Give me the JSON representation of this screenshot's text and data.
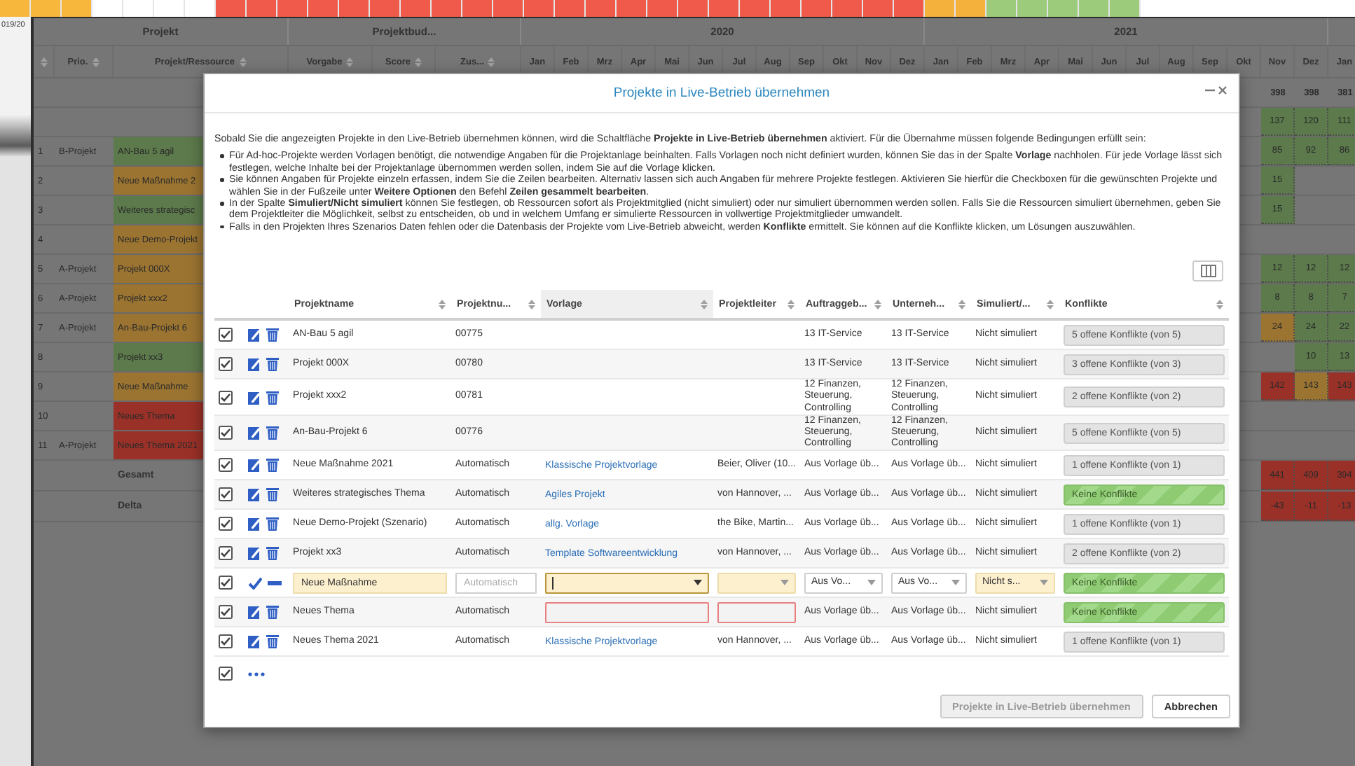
{
  "top_strip": [
    {
      "color": "#f6b73c"
    },
    {
      "color": "#f6b73c"
    },
    {
      "color": "#f6b73c"
    },
    {
      "color": "#ffffff"
    },
    {
      "color": "#ffffff"
    },
    {
      "color": "#ffffff"
    },
    {
      "color": "#ffffff"
    },
    {
      "color": "#ef5a4a"
    },
    {
      "color": "#ef5a4a"
    },
    {
      "color": "#ef5a4a"
    },
    {
      "color": "#ef5a4a"
    },
    {
      "color": "#ef5a4a"
    },
    {
      "color": "#ef5a4a"
    },
    {
      "color": "#ef5a4a"
    },
    {
      "color": "#ef5a4a"
    },
    {
      "color": "#ef5a4a"
    },
    {
      "color": "#ef5a4a"
    },
    {
      "color": "#ef5a4a"
    },
    {
      "color": "#ef5a4a"
    },
    {
      "color": "#ef5a4a"
    },
    {
      "color": "#ef5a4a"
    },
    {
      "color": "#ef5a4a"
    },
    {
      "color": "#ef5a4a"
    },
    {
      "color": "#ef5a4a"
    },
    {
      "color": "#ef5a4a"
    },
    {
      "color": "#ef5a4a"
    },
    {
      "color": "#ef5a4a"
    },
    {
      "color": "#ef5a4a"
    },
    {
      "color": "#ef5a4a"
    },
    {
      "color": "#ef5a4a"
    },
    {
      "color": "#f4b23d"
    },
    {
      "color": "#f4b23d"
    },
    {
      "color": "#9dcb7c"
    },
    {
      "color": "#9dcb7c"
    },
    {
      "color": "#9dcb7c"
    },
    {
      "color": "#9dcb7c"
    },
    {
      "color": "#9dcb7c"
    }
  ],
  "side_panel": {
    "label": "019/20"
  },
  "grid": {
    "groups": [
      {
        "label": "Projekt"
      },
      {
        "label": "Projektbud..."
      },
      {
        "label": "2020"
      },
      {
        "label": "2021"
      }
    ],
    "columns": [
      {
        "sortable": true
      },
      {
        "label": "Prio.",
        "sortable": true
      },
      {
        "label": "Projekt/Ressource",
        "sortable": true
      },
      {
        "label": "Vorgabe",
        "sortable": true
      },
      {
        "label": "Score",
        "sortable": true
      },
      {
        "label": "Zus...",
        "sortable": true
      },
      {
        "label": "Jan",
        "sortable": false
      },
      {
        "label": "Feb",
        "sortable": false
      },
      {
        "label": "Mrz",
        "sortable": false
      },
      {
        "label": "Apr",
        "sortable": false
      },
      {
        "label": "Mai",
        "sortable": false
      },
      {
        "label": "Jun",
        "sortable": false
      },
      {
        "label": "Jul",
        "sortable": false
      },
      {
        "label": "Aug",
        "sortable": false
      },
      {
        "label": "Sep",
        "sortable": false
      },
      {
        "label": "Okt",
        "sortable": false
      },
      {
        "label": "Nov",
        "sortable": false
      },
      {
        "label": "Dez",
        "sortable": false
      },
      {
        "label": "Jan",
        "sortable": false
      },
      {
        "label": "Feb",
        "sortable": false
      },
      {
        "label": "Mrz",
        "sortable": false
      },
      {
        "label": "Apr",
        "sortable": false
      },
      {
        "label": "Mai",
        "sortable": false
      },
      {
        "label": "Jun",
        "sortable": false
      },
      {
        "label": "Jul",
        "sortable": false
      },
      {
        "label": "Aug",
        "sortable": false
      },
      {
        "label": "Sep",
        "sortable": false
      },
      {
        "label": "Okt",
        "sortable": false
      },
      {
        "label": "Nov",
        "sortable": false
      },
      {
        "label": "Dez",
        "sortable": false
      },
      {
        "label": "Jan",
        "sortable": false
      }
    ],
    "totals": [
      {
        "cells": [
          {
            "kind": "plain",
            "text": "398"
          },
          {
            "kind": "plain",
            "text": "398"
          },
          {
            "kind": "plain",
            "text": "381"
          }
        ]
      },
      {
        "cells": [
          {
            "kind": "value",
            "text": "137",
            "color": "#5c7a4b"
          },
          {
            "kind": "value",
            "text": "120",
            "color": "#5c7a4b"
          },
          {
            "kind": "value",
            "text": "111",
            "color": "#5c7a4b"
          }
        ]
      }
    ],
    "rows": [
      {
        "no": "1",
        "prio": "B-Projekt",
        "name": "AN-Bau 5 agil",
        "color": "#5c7a4b",
        "cells": [
          {
            "kind": "value",
            "text": "85",
            "color": "#5c7a4b"
          },
          {
            "kind": "value",
            "text": "92",
            "color": "#5c7a4b"
          },
          {
            "kind": "value",
            "text": "86",
            "color": "#5c7a4b"
          }
        ]
      },
      {
        "no": "2",
        "name": "Neue Maßnahme 2",
        "color": "#9b7431",
        "cells": [
          {
            "kind": "value",
            "text": "15",
            "color": "#5c7a4b"
          },
          {
            "kind": "empty"
          },
          {
            "kind": "empty"
          }
        ]
      },
      {
        "no": "3",
        "name": "Weiteres strategisc",
        "color": "#5c7a4b",
        "cells": [
          {
            "kind": "value",
            "text": "15",
            "color": "#5c7a4b"
          },
          {
            "kind": "empty"
          },
          {
            "kind": "empty"
          }
        ]
      },
      {
        "no": "4",
        "name": "Neue Demo-Projekt",
        "color": "#9b7431",
        "cells": [
          {
            "kind": "empty"
          },
          {
            "kind": "empty"
          },
          {
            "kind": "empty"
          }
        ]
      },
      {
        "no": "5",
        "prio": "A-Projekt",
        "name": "Projekt 000X",
        "color": "#9b7431",
        "cells": [
          {
            "kind": "value",
            "text": "12",
            "color": "#5c7a4b"
          },
          {
            "kind": "value",
            "text": "12",
            "color": "#5c7a4b"
          },
          {
            "kind": "value",
            "text": "12",
            "color": "#5c7a4b"
          }
        ]
      },
      {
        "no": "6",
        "prio": "A-Projekt",
        "name": "Projekt xxx2",
        "color": "#9b7431",
        "cells": [
          {
            "kind": "value",
            "text": "8",
            "color": "#5c7a4b"
          },
          {
            "kind": "value",
            "text": "8",
            "color": "#5c7a4b"
          },
          {
            "kind": "value",
            "text": "7",
            "color": "#5c7a4b"
          }
        ]
      },
      {
        "no": "7",
        "prio": "A-Projekt",
        "name": "An-Bau-Projekt 6",
        "color": "#9b7431",
        "cells": [
          {
            "kind": "value",
            "text": "24",
            "color": "#9b7431"
          },
          {
            "kind": "value",
            "text": "24",
            "color": "#5c7a4b"
          },
          {
            "kind": "value",
            "text": "22",
            "color": "#5c7a4b"
          }
        ]
      },
      {
        "no": "8",
        "name": "Projekt xx3",
        "color": "#5c7a4b",
        "cells": [
          {
            "kind": "empty"
          },
          {
            "kind": "value",
            "text": "10",
            "color": "#5c7a4b"
          },
          {
            "kind": "value",
            "text": "13",
            "color": "#5c7a4b"
          }
        ]
      },
      {
        "no": "9",
        "name": "Neue Maßnahme",
        "color": "#9b7431",
        "cells": [
          {
            "kind": "value",
            "text": "142",
            "color": "#9a3128"
          },
          {
            "kind": "value",
            "text": "143",
            "color": "#9b7431"
          },
          {
            "kind": "value",
            "text": "143",
            "color": "#9a3128"
          }
        ]
      },
      {
        "no": "10",
        "name": "Neues Thema",
        "color": "#9a3128",
        "cells": [
          {
            "kind": "empty"
          },
          {
            "kind": "empty"
          },
          {
            "kind": "empty"
          }
        ]
      },
      {
        "no": "11",
        "prio": "A-Projekt",
        "name": "Neues Thema 2021",
        "color": "#9a3128",
        "cells": [
          {
            "kind": "empty"
          },
          {
            "kind": "empty"
          },
          {
            "kind": "empty"
          }
        ]
      }
    ],
    "sums": [
      {
        "label": "Gesamt",
        "cells": [
          {
            "kind": "value",
            "text": "441",
            "color": "#9a3128"
          },
          {
            "kind": "value",
            "text": "409",
            "color": "#9a3128"
          },
          {
            "kind": "value",
            "text": "394",
            "color": "#9a3128"
          }
        ]
      },
      {
        "label": "Delta",
        "cells": [
          {
            "kind": "value",
            "text": "-43",
            "color": "#9a3128"
          },
          {
            "kind": "value",
            "text": "-11",
            "color": "#9a3128"
          },
          {
            "kind": "value",
            "text": "-13",
            "color": "#9a3128"
          }
        ]
      }
    ]
  },
  "dialog": {
    "title": "Projekte in Live-Betrieb übernehmen",
    "intro": "Sobald Sie die angezeigten Projekte in den Live-Betrieb übernehmen können, wird die Schaltfläche **Projekte in Live-Betrieb übernehmen** aktiviert. Für die Übernahme müssen folgende Bedingungen erfüllt sein:",
    "bullets": [
      "Für Ad-hoc-Projekte werden Vorlagen benötigt, die notwendige Angaben für die Projektanlage beinhalten. Falls Vorlagen noch nicht definiert wurden, können Sie das in der Spalte **Vorlage** nachholen. Für jede Vorlage lässt sich festlegen, welche Inhalte bei der Projektanlage übernommen werden sollen, indem Sie auf die Vorlage klicken.",
      "Sie können Angaben für Projekte einzeln erfassen, indem Sie die Zeilen bearbeiten. Alternativ lassen sich auch Angaben für mehrere Projekte festlegen. Aktivieren Sie hierfür die Checkboxen für die gewünschten Projekte und wählen Sie in der Fußzeile unter **Weitere Optionen** den Befehl **Zeilen gesammelt bearbeiten**.",
      "In der Spalte **Simuliert/Nicht simuliert** können Sie festlegen, ob Ressourcen sofort als Projektmitglied (nicht simuliert) oder nur simuliert übernommen werden sollen. Falls Sie die Ressourcen simuliert übernehmen, geben Sie dem Projektleiter die Möglichkeit, selbst zu entscheiden, ob und in welchem Umfang er simulierte Ressourcen in vollwertige Projektmitglieder umwandelt.",
      "Falls in den Projekten Ihres Szenarios Daten fehlen oder die Datenbasis der Projekte vom Live-Betrieb abweicht, werden **Konflikte** ermittelt. Sie können auf die Konflikte klicken, um Lösungen auszuwählen."
    ],
    "table": {
      "columns": [
        {
          "label": "Projektname",
          "sorted": false
        },
        {
          "label": "Projektnu...",
          "sorted": false
        },
        {
          "label": "Vorlage",
          "sorted": true
        },
        {
          "label": "Projektleiter",
          "sorted": false
        },
        {
          "label": "Auftraggeb...",
          "sorted": false
        },
        {
          "label": "Unterneh...",
          "sorted": false
        },
        {
          "label": "Simuliert/...",
          "sorted": false
        },
        {
          "label": "Konflikte",
          "sorted": false
        }
      ],
      "rows": [
        {
          "kind": "view",
          "checked": true,
          "name": "AN-Bau 5 agil",
          "number": "00775",
          "client": "13 IT-Service",
          "company": "13 IT-Service",
          "simulated": "Nicht simuliert",
          "conflicts": "5 offene Konflikte (von 5)",
          "resolved": false,
          "invalid": false
        },
        {
          "kind": "view",
          "checked": true,
          "name": "Projekt 000X",
          "number": "00780",
          "client": "13 IT-Service",
          "company": "13 IT-Service",
          "simulated": "Nicht simuliert",
          "conflicts": "3 offene Konflikte (von 3)",
          "resolved": false,
          "invalid": false
        },
        {
          "kind": "view",
          "checked": true,
          "name": "Projekt xxx2",
          "number": "00781",
          "client": "12 Finanzen, Steuerung, Controlling",
          "company": "12 Finanzen, Steuerung, Controlling",
          "simulated": "Nicht simuliert",
          "conflicts": "2 offene Konflikte (von 2)",
          "resolved": false,
          "invalid": false
        },
        {
          "kind": "view",
          "checked": true,
          "name": "An-Bau-Projekt 6",
          "number": "00776",
          "client": "12 Finanzen, Steuerung, Controlling",
          "company": "12 Finanzen, Steuerung, Controlling",
          "simulated": "Nicht simuliert",
          "conflicts": "5 offene Konflikte (von 5)",
          "resolved": false,
          "invalid": false
        },
        {
          "kind": "view",
          "checked": true,
          "name": "Neue Maßnahme 2021",
          "number": "Automatisch",
          "template": "Klassische Projektvorlage",
          "leader": "Beier, Oliver (10...",
          "client": "Aus Vorlage üb...",
          "company": "Aus Vorlage üb...",
          "simulated": "Nicht simuliert",
          "conflicts": "1 offene Konflikte (von 1)",
          "resolved": false,
          "invalid": false
        },
        {
          "kind": "view",
          "checked": true,
          "name": "Weiteres strategisches Thema",
          "number": "Automatisch",
          "template": "Agiles Projekt",
          "leader": "von Hannover, ...",
          "client": "Aus Vorlage üb...",
          "company": "Aus Vorlage üb...",
          "simulated": "Nicht simuliert",
          "conflicts": "Keine Konflikte",
          "resolved": true,
          "invalid": false
        },
        {
          "kind": "view",
          "checked": true,
          "name": "Neue Demo-Projekt (Szenario)",
          "number": "Automatisch",
          "template": "allg. Vorlage",
          "leader": "the Bike, Martin...",
          "client": "Aus Vorlage üb...",
          "company": "Aus Vorlage üb...",
          "simulated": "Nicht simuliert",
          "conflicts": "1 offene Konflikte (von 1)",
          "resolved": false,
          "invalid": false
        },
        {
          "kind": "view",
          "checked": true,
          "name": "Projekt xx3",
          "number": "Automatisch",
          "template": "Template Softwareentwicklung",
          "leader": "von Hannover, ...",
          "client": "Aus Vorlage üb...",
          "company": "Aus Vorlage üb...",
          "simulated": "Nicht simuliert",
          "conflicts": "2 offene Konflikte (von 2)",
          "resolved": false,
          "invalid": false
        },
        {
          "kind": "edit",
          "checked": true,
          "fields": [
            {
              "kind": "text",
              "value": "Neue Maßnahme",
              "required": true
            },
            {
              "kind": "text",
              "placeholder": "Automatisch",
              "required": false
            },
            {
              "kind": "select",
              "required": true,
              "focused": true
            },
            {
              "kind": "select",
              "required": true,
              "focused": false
            },
            {
              "kind": "select",
              "value": "Aus Vo...",
              "required": false,
              "focused": false
            },
            {
              "kind": "select",
              "value": "Aus Vo...",
              "required": false,
              "focused": false
            },
            {
              "kind": "select",
              "value": "Nicht s...",
              "required": true,
              "focused": false
            }
          ],
          "conflicts": "Keine Konflikte",
          "resolved": true
        },
        {
          "kind": "view",
          "checked": true,
          "name": "Neues Thema",
          "number": "Automatisch",
          "client": "Aus Vorlage üb...",
          "company": "Aus Vorlage üb...",
          "simulated": "Nicht simuliert",
          "conflicts": "Keine Konflikte",
          "resolved": true,
          "invalid": true
        },
        {
          "kind": "view",
          "checked": true,
          "name": "Neues Thema 2021",
          "number": "Automatisch",
          "template": "Klassische Projektvorlage",
          "leader": "von Hannover, ...",
          "client": "Aus Vorlage üb...",
          "company": "Aus Vorlage üb...",
          "simulated": "Nicht simuliert",
          "conflicts": "1 offene Konflikte (von 1)",
          "resolved": false,
          "invalid": false
        }
      ],
      "footer": {
        "checked": true
      }
    },
    "buttons": [
      {
        "label": "Projekte in Live-Betrieb übernehmen",
        "disabled": true
      },
      {
        "label": "Abbrechen",
        "disabled": false
      }
    ]
  }
}
